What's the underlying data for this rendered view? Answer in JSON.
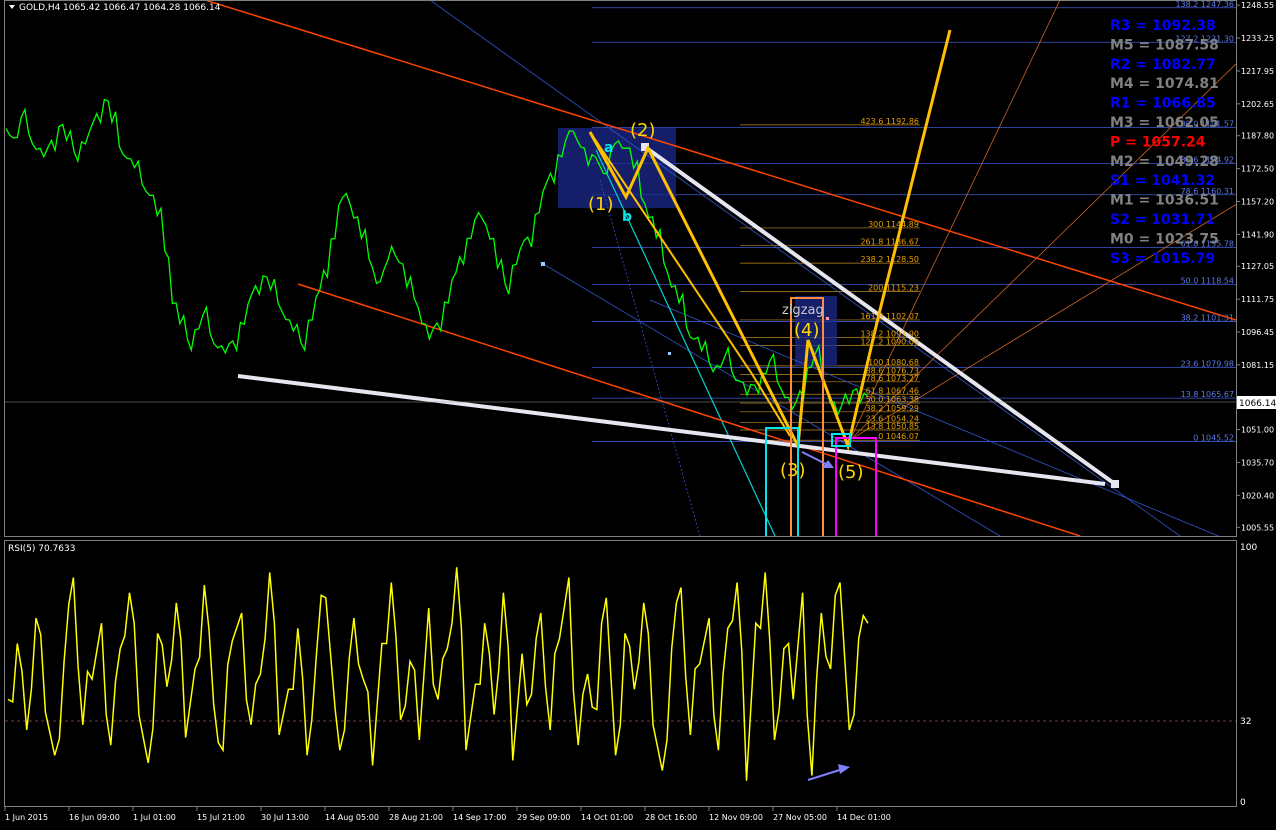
{
  "header": {
    "title": "GOLD,H4",
    "ohlc": "1065.42 1066.47 1064.28 1066.14"
  },
  "chart_data": [
    {
      "type": "line",
      "panel": "price",
      "symbol": "GOLD",
      "timeframe": "H4",
      "ylim": [
        1001.5,
        1250.5
      ],
      "y_ticks": [
        "1248.55",
        "1233.25",
        "1217.95",
        "1202.65",
        "1187.80",
        "1172.50",
        "1157.20",
        "1141.90",
        "1127.05",
        "1111.75",
        "1096.45",
        "1081.15",
        "1066.14",
        "1051.00",
        "1035.70",
        "1020.40",
        "1005.55"
      ],
      "current_price": "1066.14",
      "x_labels": [
        "1 Jun 2015",
        "16 Jun 09:00",
        "1 Jul 01:00",
        "15 Jul 21:00",
        "30 Jul 13:00",
        "14 Aug 05:00",
        "28 Aug 21:00",
        "14 Sep 17:00",
        "29 Sep 09:00",
        "14 Oct 01:00",
        "28 Oct 16:00",
        "12 Nov 09:00",
        "27 Nov 05:00",
        "14 Dec 01:00"
      ],
      "price_series": [
        1192,
        1187,
        1196,
        1188,
        1182,
        1178,
        1185,
        1193,
        1186,
        1180,
        1184,
        1190,
        1198,
        1204,
        1195,
        1183,
        1177,
        1172,
        1166,
        1160,
        1150,
        1135,
        1110,
        1100,
        1092,
        1098,
        1104,
        1095,
        1090,
        1087,
        1092,
        1100,
        1110,
        1118,
        1122,
        1117,
        1110,
        1102,
        1096,
        1092,
        1102,
        1112,
        1126,
        1140,
        1155,
        1160,
        1150,
        1140,
        1130,
        1120,
        1126,
        1136,
        1128,
        1118,
        1112,
        1100,
        1094,
        1101,
        1110,
        1120,
        1132,
        1140,
        1148,
        1150,
        1140,
        1126,
        1118,
        1128,
        1135,
        1140,
        1152,
        1162,
        1170,
        1178,
        1186,
        1190,
        1182,
        1175,
        1178,
        1170,
        1180,
        1186,
        1182,
        1172,
        1160,
        1150,
        1140,
        1128,
        1118,
        1110,
        1098,
        1094,
        1088,
        1082,
        1080,
        1085,
        1078,
        1073,
        1068,
        1072,
        1077,
        1082,
        1074,
        1066,
        1060,
        1070,
        1080,
        1086,
        1074,
        1064,
        1058,
        1067,
        1070,
        1064,
        1066
      ],
      "pivot_levels": [
        {
          "label": "R3",
          "value": "1092.38",
          "color": "#0000ff"
        },
        {
          "label": "M5",
          "value": "1087.58",
          "color": "#808080"
        },
        {
          "label": "R2",
          "value": "1082.77",
          "color": "#0000ff"
        },
        {
          "label": "M4",
          "value": "1074.81",
          "color": "#808080"
        },
        {
          "label": "R1",
          "value": "1066.85",
          "color": "#0000ff"
        },
        {
          "label": "M3",
          "value": "1062.05",
          "color": "#808080"
        },
        {
          "label": "P",
          "value": "1057.24",
          "color": "#ff0000"
        },
        {
          "label": "M2",
          "value": "1049.28",
          "color": "#808080"
        },
        {
          "label": "S1",
          "value": "1041.32",
          "color": "#0000ff"
        },
        {
          "label": "M1",
          "value": "1036.51",
          "color": "#808080"
        },
        {
          "label": "S2",
          "value": "1031.71",
          "color": "#0000ff"
        },
        {
          "label": "M0",
          "value": "1023.75",
          "color": "#808080"
        },
        {
          "label": "S3",
          "value": "1015.79",
          "color": "#0000ff"
        }
      ],
      "fib_blue": [
        {
          "text": "138.2 1247.36",
          "price": 1247.36
        },
        {
          "text": "127.2 1231.30",
          "price": 1231.3
        },
        {
          "text": "100.0 1191.57",
          "price": 1191.57
        },
        {
          "text": "88.6 1174.92",
          "price": 1174.92
        },
        {
          "text": "78.6 1160.31",
          "price": 1160.31
        },
        {
          "text": "61.8 1135.78",
          "price": 1135.78
        },
        {
          "text": "50.0 1118.54",
          "price": 1118.54
        },
        {
          "text": "38.2 1101.31",
          "price": 1101.31
        },
        {
          "text": "23.6 1079.98",
          "price": 1079.98
        },
        {
          "text": "13.8 1065.67",
          "price": 1065.67
        },
        {
          "text": "0 1045.52",
          "price": 1045.52
        }
      ],
      "fib_orange": [
        {
          "text": "423.6 1192.86",
          "price": 1192.86
        },
        {
          "text": "300 1144.89",
          "price": 1144.89
        },
        {
          "text": "261.8 1136.67",
          "price": 1136.67
        },
        {
          "text": "238.2 1128.50",
          "price": 1128.5
        },
        {
          "text": "200 1115.23",
          "price": 1115.23
        },
        {
          "text": "161.8 1102.07",
          "price": 1102.07
        },
        {
          "text": "138.2 1093.90",
          "price": 1093.9
        },
        {
          "text": "127.2 1090.09",
          "price": 1090.09
        },
        {
          "text": "100 1080.68",
          "price": 1080.68
        },
        {
          "text": "88.6 1076.73",
          "price": 1076.73
        },
        {
          "text": "78.6 1073.27",
          "price": 1073.27
        },
        {
          "text": "61.8 1067.46",
          "price": 1067.46
        },
        {
          "text": "50.0 1063.38",
          "price": 1063.38
        },
        {
          "text": "38.2 1059.29",
          "price": 1059.29
        },
        {
          "text": "23.6 1054.24",
          "price": 1054.24
        },
        {
          "text": "13.8 1050.85",
          "price": 1050.85
        },
        {
          "text": "0 1046.07",
          "price": 1046.07
        }
      ],
      "wave_labels": [
        "(1)",
        "(2)",
        "(3)",
        "(4)",
        "(5)",
        "a",
        "b"
      ],
      "indicator_label": "zigzag",
      "colors": {
        "price": "#00ff00",
        "wave": "#ffc000",
        "trend": "#ff4500",
        "white_line": "#e6e6f0",
        "fib_blue": "#3c5ad2",
        "fib_orange": "#e6a000",
        "cyan": "#00e5ee",
        "magenta": "#ff00ff",
        "orange_box": "#ff8c40"
      }
    },
    {
      "type": "line",
      "panel": "rsi",
      "name": "RSI(5) 70.7633",
      "ylim": [
        0,
        100
      ],
      "y_ticks": [
        "100",
        "32",
        "0"
      ],
      "level": 32,
      "values": [
        40,
        62,
        28,
        72,
        35,
        18,
        55,
        88,
        30,
        48,
        70,
        22,
        60,
        82,
        34,
        15,
        66,
        45,
        78,
        25,
        52,
        85,
        38,
        20,
        63,
        74,
        30,
        50,
        90,
        26,
        44,
        68,
        18,
        58,
        80,
        36,
        28,
        72,
        48,
        14,
        62,
        86,
        32,
        55,
        24,
        76,
        40,
        60,
        92,
        20,
        46,
        70,
        34,
        82,
        16,
        58,
        42,
        74,
        28,
        64,
        88,
        22,
        50,
        36,
        80,
        18,
        66,
        44,
        78,
        30,
        12,
        60,
        84,
        26,
        54,
        72,
        20,
        68,
        86,
        8,
        70,
        90,
        24,
        60,
        40,
        82,
        10,
        74,
        52,
        86,
        28,
        64,
        70
      ]
    }
  ]
}
